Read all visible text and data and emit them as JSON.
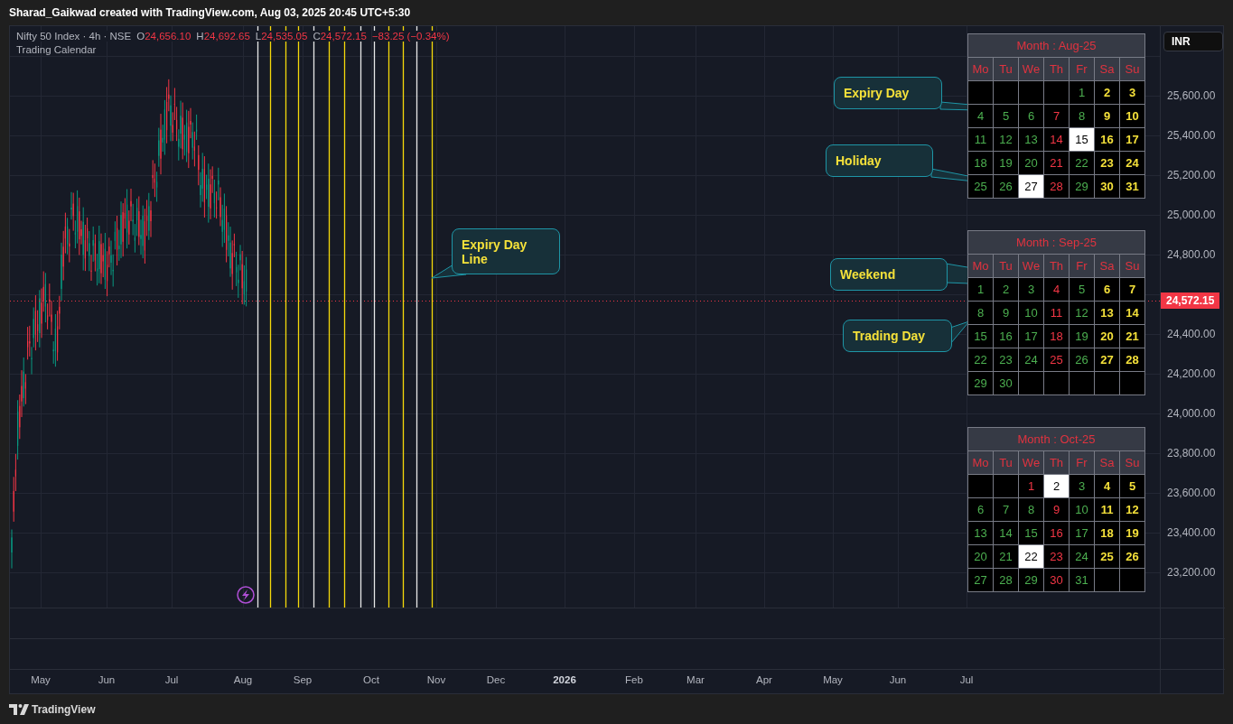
{
  "header": {
    "attribution": "Sharad_Gaikwad created with TradingView.com, Aug 03, 2025 20:45 UTC+5:30"
  },
  "legend": {
    "symbol": "Nifty 50 Index · 4h · NSE",
    "values": [
      {
        "label": "O",
        "value": "24,656.10"
      },
      {
        "label": "H",
        "value": "24,692.65"
      },
      {
        "label": "L",
        "value": "24,535.05"
      },
      {
        "label": "C",
        "value": "24,572.15"
      }
    ],
    "change": "−83.25 (−0.34%)",
    "indicator": "Trading Calendar"
  },
  "price_axis": {
    "currency": "INR",
    "labels": [
      "25,600.00",
      "25,400.00",
      "25,200.00",
      "25,000.00",
      "24,800.00",
      "24,400.00",
      "24,200.00",
      "24,000.00",
      "23,800.00",
      "23,600.00",
      "23,400.00",
      "23,200.00"
    ],
    "last_price": "24,572.15"
  },
  "calendars": [
    {
      "title": "Month : Aug-25",
      "weekdays": [
        "Mo",
        "Tu",
        "We",
        "Th",
        "Fr",
        "Sa",
        "Su"
      ],
      "weeks": [
        [
          {
            "kind": "empty"
          },
          {
            "kind": "empty"
          },
          {
            "kind": "empty"
          },
          {
            "kind": "empty"
          },
          {
            "day": "1",
            "kind": "trading"
          },
          {
            "day": "2",
            "kind": "weekend"
          },
          {
            "day": "3",
            "kind": "weekend"
          }
        ],
        [
          {
            "day": "4",
            "kind": "trading"
          },
          {
            "day": "5",
            "kind": "trading"
          },
          {
            "day": "6",
            "kind": "trading"
          },
          {
            "day": "7",
            "kind": "expiry"
          },
          {
            "day": "8",
            "kind": "trading"
          },
          {
            "day": "9",
            "kind": "weekend"
          },
          {
            "day": "10",
            "kind": "weekend"
          }
        ],
        [
          {
            "day": "11",
            "kind": "trading"
          },
          {
            "day": "12",
            "kind": "trading"
          },
          {
            "day": "13",
            "kind": "trading"
          },
          {
            "day": "14",
            "kind": "expiry"
          },
          {
            "day": "15",
            "kind": "holiday"
          },
          {
            "day": "16",
            "kind": "weekend"
          },
          {
            "day": "17",
            "kind": "weekend"
          }
        ],
        [
          {
            "day": "18",
            "kind": "trading"
          },
          {
            "day": "19",
            "kind": "trading"
          },
          {
            "day": "20",
            "kind": "trading"
          },
          {
            "day": "21",
            "kind": "expiry"
          },
          {
            "day": "22",
            "kind": "trading"
          },
          {
            "day": "23",
            "kind": "weekend"
          },
          {
            "day": "24",
            "kind": "weekend"
          }
        ],
        [
          {
            "day": "25",
            "kind": "trading"
          },
          {
            "day": "26",
            "kind": "trading"
          },
          {
            "day": "27",
            "kind": "holiday"
          },
          {
            "day": "28",
            "kind": "expiry"
          },
          {
            "day": "29",
            "kind": "trading"
          },
          {
            "day": "30",
            "kind": "weekend"
          },
          {
            "day": "31",
            "kind": "weekend"
          }
        ]
      ]
    },
    {
      "title": "Month : Sep-25",
      "weekdays": [
        "Mo",
        "Tu",
        "We",
        "Th",
        "Fr",
        "Sa",
        "Su"
      ],
      "weeks": [
        [
          {
            "day": "1",
            "kind": "trading"
          },
          {
            "day": "2",
            "kind": "trading"
          },
          {
            "day": "3",
            "kind": "trading"
          },
          {
            "day": "4",
            "kind": "expiry"
          },
          {
            "day": "5",
            "kind": "trading"
          },
          {
            "day": "6",
            "kind": "weekend"
          },
          {
            "day": "7",
            "kind": "weekend"
          }
        ],
        [
          {
            "day": "8",
            "kind": "trading"
          },
          {
            "day": "9",
            "kind": "trading"
          },
          {
            "day": "10",
            "kind": "trading"
          },
          {
            "day": "11",
            "kind": "expiry"
          },
          {
            "day": "12",
            "kind": "trading"
          },
          {
            "day": "13",
            "kind": "weekend"
          },
          {
            "day": "14",
            "kind": "weekend"
          }
        ],
        [
          {
            "day": "15",
            "kind": "trading"
          },
          {
            "day": "16",
            "kind": "trading"
          },
          {
            "day": "17",
            "kind": "trading"
          },
          {
            "day": "18",
            "kind": "expiry"
          },
          {
            "day": "19",
            "kind": "trading"
          },
          {
            "day": "20",
            "kind": "weekend"
          },
          {
            "day": "21",
            "kind": "weekend"
          }
        ],
        [
          {
            "day": "22",
            "kind": "trading"
          },
          {
            "day": "23",
            "kind": "trading"
          },
          {
            "day": "24",
            "kind": "trading"
          },
          {
            "day": "25",
            "kind": "expiry"
          },
          {
            "day": "26",
            "kind": "trading"
          },
          {
            "day": "27",
            "kind": "weekend"
          },
          {
            "day": "28",
            "kind": "weekend"
          }
        ],
        [
          {
            "day": "29",
            "kind": "trading"
          },
          {
            "day": "30",
            "kind": "trading"
          },
          {
            "kind": "empty"
          },
          {
            "kind": "empty"
          },
          {
            "kind": "empty"
          },
          {
            "kind": "empty"
          },
          {
            "kind": "empty"
          }
        ]
      ]
    },
    {
      "title": "Month : Oct-25",
      "weekdays": [
        "Mo",
        "Tu",
        "We",
        "Th",
        "Fr",
        "Sa",
        "Su"
      ],
      "weeks": [
        [
          {
            "kind": "empty"
          },
          {
            "kind": "empty"
          },
          {
            "day": "1",
            "kind": "expiry"
          },
          {
            "day": "2",
            "kind": "holiday"
          },
          {
            "day": "3",
            "kind": "trading"
          },
          {
            "day": "4",
            "kind": "weekend"
          },
          {
            "day": "5",
            "kind": "weekend"
          }
        ],
        [
          {
            "day": "6",
            "kind": "trading"
          },
          {
            "day": "7",
            "kind": "trading"
          },
          {
            "day": "8",
            "kind": "trading"
          },
          {
            "day": "9",
            "kind": "expiry"
          },
          {
            "day": "10",
            "kind": "trading"
          },
          {
            "day": "11",
            "kind": "weekend"
          },
          {
            "day": "12",
            "kind": "weekend"
          }
        ],
        [
          {
            "day": "13",
            "kind": "trading"
          },
          {
            "day": "14",
            "kind": "trading"
          },
          {
            "day": "15",
            "kind": "trading"
          },
          {
            "day": "16",
            "kind": "expiry"
          },
          {
            "day": "17",
            "kind": "trading"
          },
          {
            "day": "18",
            "kind": "weekend"
          },
          {
            "day": "19",
            "kind": "weekend"
          }
        ],
        [
          {
            "day": "20",
            "kind": "trading"
          },
          {
            "day": "21",
            "kind": "trading"
          },
          {
            "day": "22",
            "kind": "holiday"
          },
          {
            "day": "23",
            "kind": "expiry"
          },
          {
            "day": "24",
            "kind": "trading"
          },
          {
            "day": "25",
            "kind": "weekend"
          },
          {
            "day": "26",
            "kind": "weekend"
          }
        ],
        [
          {
            "day": "27",
            "kind": "trading"
          },
          {
            "day": "28",
            "kind": "trading"
          },
          {
            "day": "29",
            "kind": "trading"
          },
          {
            "day": "30",
            "kind": "expiry"
          },
          {
            "day": "31",
            "kind": "trading"
          },
          {
            "kind": "empty"
          },
          {
            "kind": "empty"
          }
        ]
      ]
    }
  ],
  "callouts": [
    {
      "text": "Expiry Day"
    },
    {
      "text": "Holiday"
    },
    {
      "text": "Weekend"
    },
    {
      "text": "Trading Day"
    },
    {
      "text": "Expiry Day Line"
    }
  ],
  "time_axis": [
    {
      "label": "May",
      "kind": "month"
    },
    {
      "label": "Jun",
      "kind": "month"
    },
    {
      "label": "Jul",
      "kind": "month"
    },
    {
      "label": "Aug",
      "kind": "month"
    },
    {
      "label": "Sep",
      "kind": "month"
    },
    {
      "label": "Oct",
      "kind": "month"
    },
    {
      "label": "Nov",
      "kind": "month"
    },
    {
      "label": "Dec",
      "kind": "month"
    },
    {
      "label": "2026",
      "kind": "year"
    },
    {
      "label": "Feb",
      "kind": "month"
    },
    {
      "label": "Mar",
      "kind": "month"
    },
    {
      "label": "Apr",
      "kind": "month"
    },
    {
      "label": "May",
      "kind": "month"
    },
    {
      "label": "Jun",
      "kind": "month"
    },
    {
      "label": "Jul",
      "kind": "month"
    }
  ],
  "footer": {
    "brand": "TradingView"
  }
}
